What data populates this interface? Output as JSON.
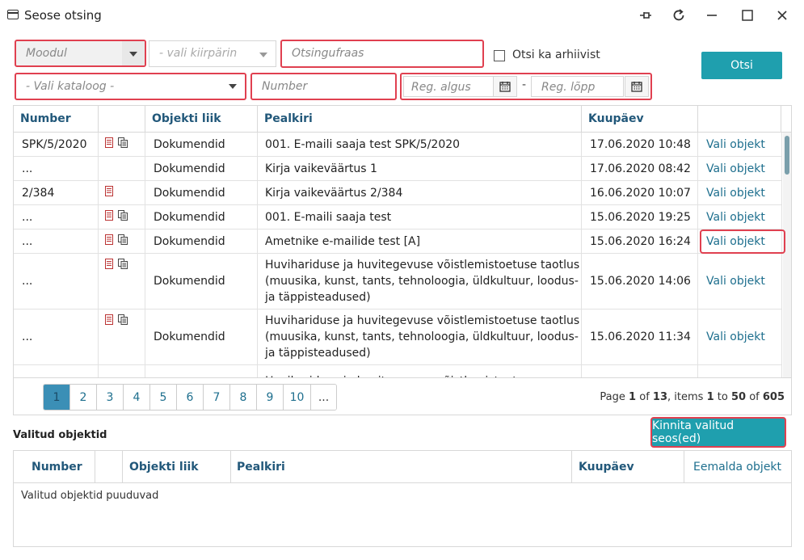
{
  "window": {
    "title": "Seose otsing"
  },
  "filters": {
    "module_placeholder": "Moodul",
    "quickpick_placeholder": "- vali kiirpärin",
    "search_placeholder": "Otsingufraas",
    "archive_label": "Otsi ka arhiivist",
    "search_button": "Otsi",
    "catalog_placeholder": "- Vali kataloog -",
    "number_placeholder": "Number",
    "reg_start_placeholder": "Reg. algus",
    "reg_end_placeholder": "Reg. lõpp",
    "date_separator": "-"
  },
  "results": {
    "columns": [
      "Number",
      "",
      "Objekti liik",
      "Pealkiri",
      "Kuupäev",
      ""
    ],
    "rows": [
      {
        "number": "SPK/5/2020",
        "icons": [
          "document-icon",
          "attachment-icon"
        ],
        "type": "Dokumendid",
        "title": "001. E-maili saaja test SPK/5/2020",
        "date": "17.06.2020 10:48",
        "action": "Vali objekt"
      },
      {
        "number": "...",
        "icons": [],
        "type": "Dokumendid",
        "title": "Kirja vaikeväärtus 1",
        "date": "17.06.2020 08:42",
        "action": "Vali objekt"
      },
      {
        "number": "2/384",
        "icons": [
          "document-icon"
        ],
        "type": "Dokumendid",
        "title": "Kirja vaikeväärtus 2/384",
        "date": "16.06.2020 10:07",
        "action": "Vali objekt"
      },
      {
        "number": "...",
        "icons": [
          "document-icon",
          "attachment-icon"
        ],
        "type": "Dokumendid",
        "title": "001. E-maili saaja test",
        "date": "15.06.2020 19:25",
        "action": "Vali objekt"
      },
      {
        "number": "...",
        "icons": [
          "document-icon",
          "attachment-icon"
        ],
        "type": "Dokumendid",
        "title": "Ametnike e-mailide test [A]",
        "date": "15.06.2020 16:24",
        "action": "Vali objekt"
      },
      {
        "number": "...",
        "icons": [
          "document-icon",
          "attachment-icon"
        ],
        "type": "Dokumendid",
        "title": "Huvihariduse ja huvitegevuse võistlemistoetuse taotlus (muusika, kunst, tants, tehnoloogia, üldkultuur, loodus- ja täppisteadused)",
        "date": "15.06.2020 14:06",
        "action": "Vali objekt"
      },
      {
        "number": "...",
        "icons": [
          "document-icon",
          "attachment-icon"
        ],
        "type": "Dokumendid",
        "title": "Huvihariduse ja huvitegevuse võistlemistoetuse taotlus (muusika, kunst, tants, tehnoloogia, üldkultuur, loodus- ja täppisteadused)",
        "date": "15.06.2020 11:34",
        "action": "Vali objekt"
      },
      {
        "number": "",
        "icons": [],
        "type": "",
        "title": "Huvihariduse ja huvitegevuse võistlemistoetuse",
        "date": "",
        "action": ""
      }
    ]
  },
  "pager": {
    "pages": [
      "1",
      "2",
      "3",
      "4",
      "5",
      "6",
      "7",
      "8",
      "9",
      "10",
      "..."
    ],
    "active": "1",
    "info": {
      "prefix": "Page",
      "page": "1",
      "of_label": "of",
      "total_pages": "13",
      "items_label": ", items",
      "from": "1",
      "to_label": "to",
      "to": "50",
      "of2_label": "of",
      "total_items": "605"
    }
  },
  "selected": {
    "title": "Valitud objektid",
    "confirm_button": "Kinnita valitud seos(ed)",
    "columns": [
      "Number",
      "",
      "Objekti liik",
      "Pealkiri",
      "Kuupäev",
      "Eemalda objekt"
    ],
    "empty": "Valitud objektid puuduvad"
  },
  "colors": {
    "accent": "#1f9fae",
    "link": "#1e6f8e",
    "header_text": "#22587a",
    "highlight": "#e04050"
  }
}
